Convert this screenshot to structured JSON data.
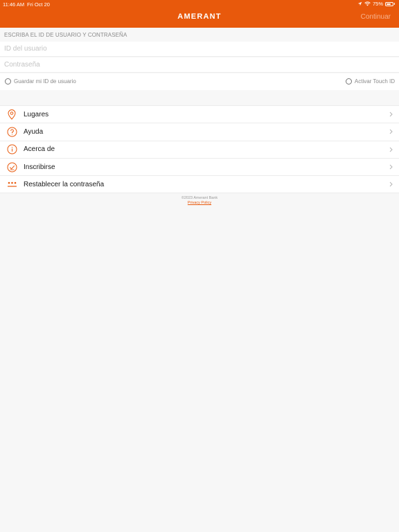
{
  "status_bar": {
    "time": "11:46 AM",
    "date": "Fri Oct 20",
    "battery": "75%",
    "battery_level": 0.75
  },
  "nav": {
    "title": "AMERANT",
    "action_label": "Continuar"
  },
  "login": {
    "section_header": "ESCRIBA EL ID DE USUARIO Y CONTRASEÑA",
    "user_id_placeholder": "ID del usuario",
    "user_id_value": "",
    "password_placeholder": "Contraseña",
    "password_value": "",
    "save_id_label": "Guardar mi ID de usuario",
    "touch_id_label": "Activar Touch ID"
  },
  "menu": {
    "items": [
      {
        "label": "Lugares",
        "icon": "location-pin-icon"
      },
      {
        "label": "Ayuda",
        "icon": "question-circle-icon"
      },
      {
        "label": "Acerca de",
        "icon": "info-circle-icon"
      },
      {
        "label": "Inscribirse",
        "icon": "check-circle-icon"
      },
      {
        "label": "Restablecer la contraseña",
        "icon": "password-dots-icon"
      }
    ]
  },
  "footer": {
    "copyright": "©2023 Amerant Bank",
    "privacy_link": "Privacy Policy"
  },
  "colors": {
    "accent": "#e8590c",
    "background": "#f7f7f7"
  }
}
